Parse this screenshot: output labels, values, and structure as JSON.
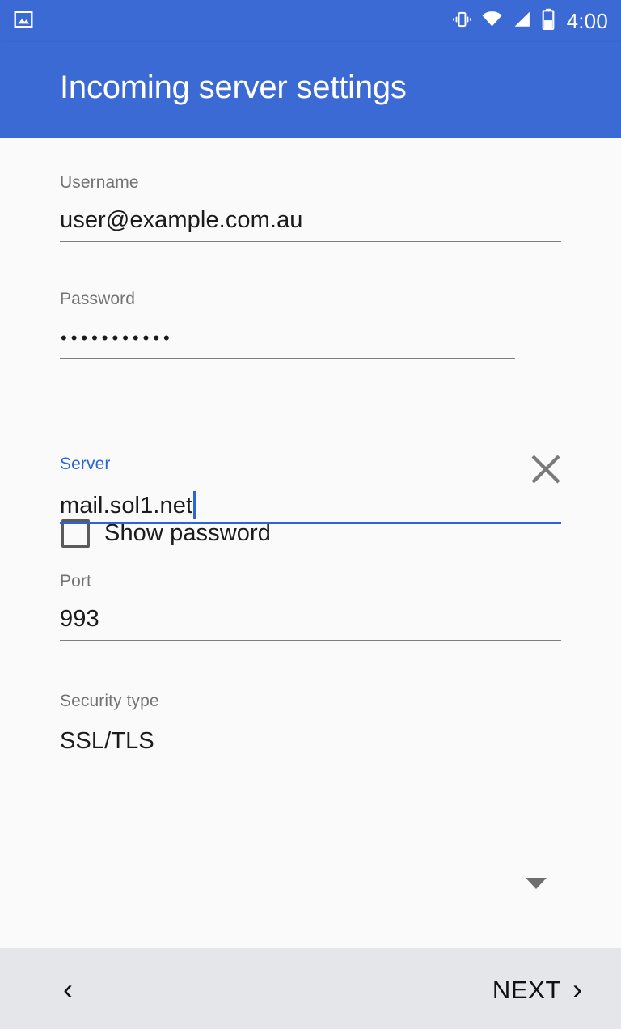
{
  "status_bar": {
    "notification_icon": "photo-image-icon",
    "icons": [
      "vibrate-icon",
      "wifi-icon",
      "cellular-signal-icon",
      "battery-half-icon"
    ],
    "time": "4:00",
    "background_color": "#3B6AD4",
    "foreground_color": "#FFFFFF"
  },
  "app_bar": {
    "title": "Incoming server settings",
    "background_color": "#3B6AD4"
  },
  "form": {
    "username": {
      "label": "Username",
      "value": "user@example.com.au",
      "focused": false
    },
    "password": {
      "label": "Password",
      "value": "•••••••••••",
      "masked_char_count": 11,
      "focused": false,
      "clear_icon": "close-x-icon"
    },
    "show_password": {
      "label": "Show password",
      "checked": false
    },
    "server": {
      "label": "Server",
      "value": "mail.sol1.net",
      "focused": true,
      "accent_color": "#2B63D9"
    },
    "port": {
      "label": "Port",
      "value": "993",
      "focused": false
    },
    "security_type": {
      "label": "Security type",
      "value": "SSL/TLS",
      "focused": false,
      "arrow_icon": "chevron-down-icon"
    }
  },
  "bottom_bar": {
    "back_label": "‹",
    "next_label": "NEXT",
    "next_chevron": "›",
    "background_color": "#E4E6E9"
  }
}
